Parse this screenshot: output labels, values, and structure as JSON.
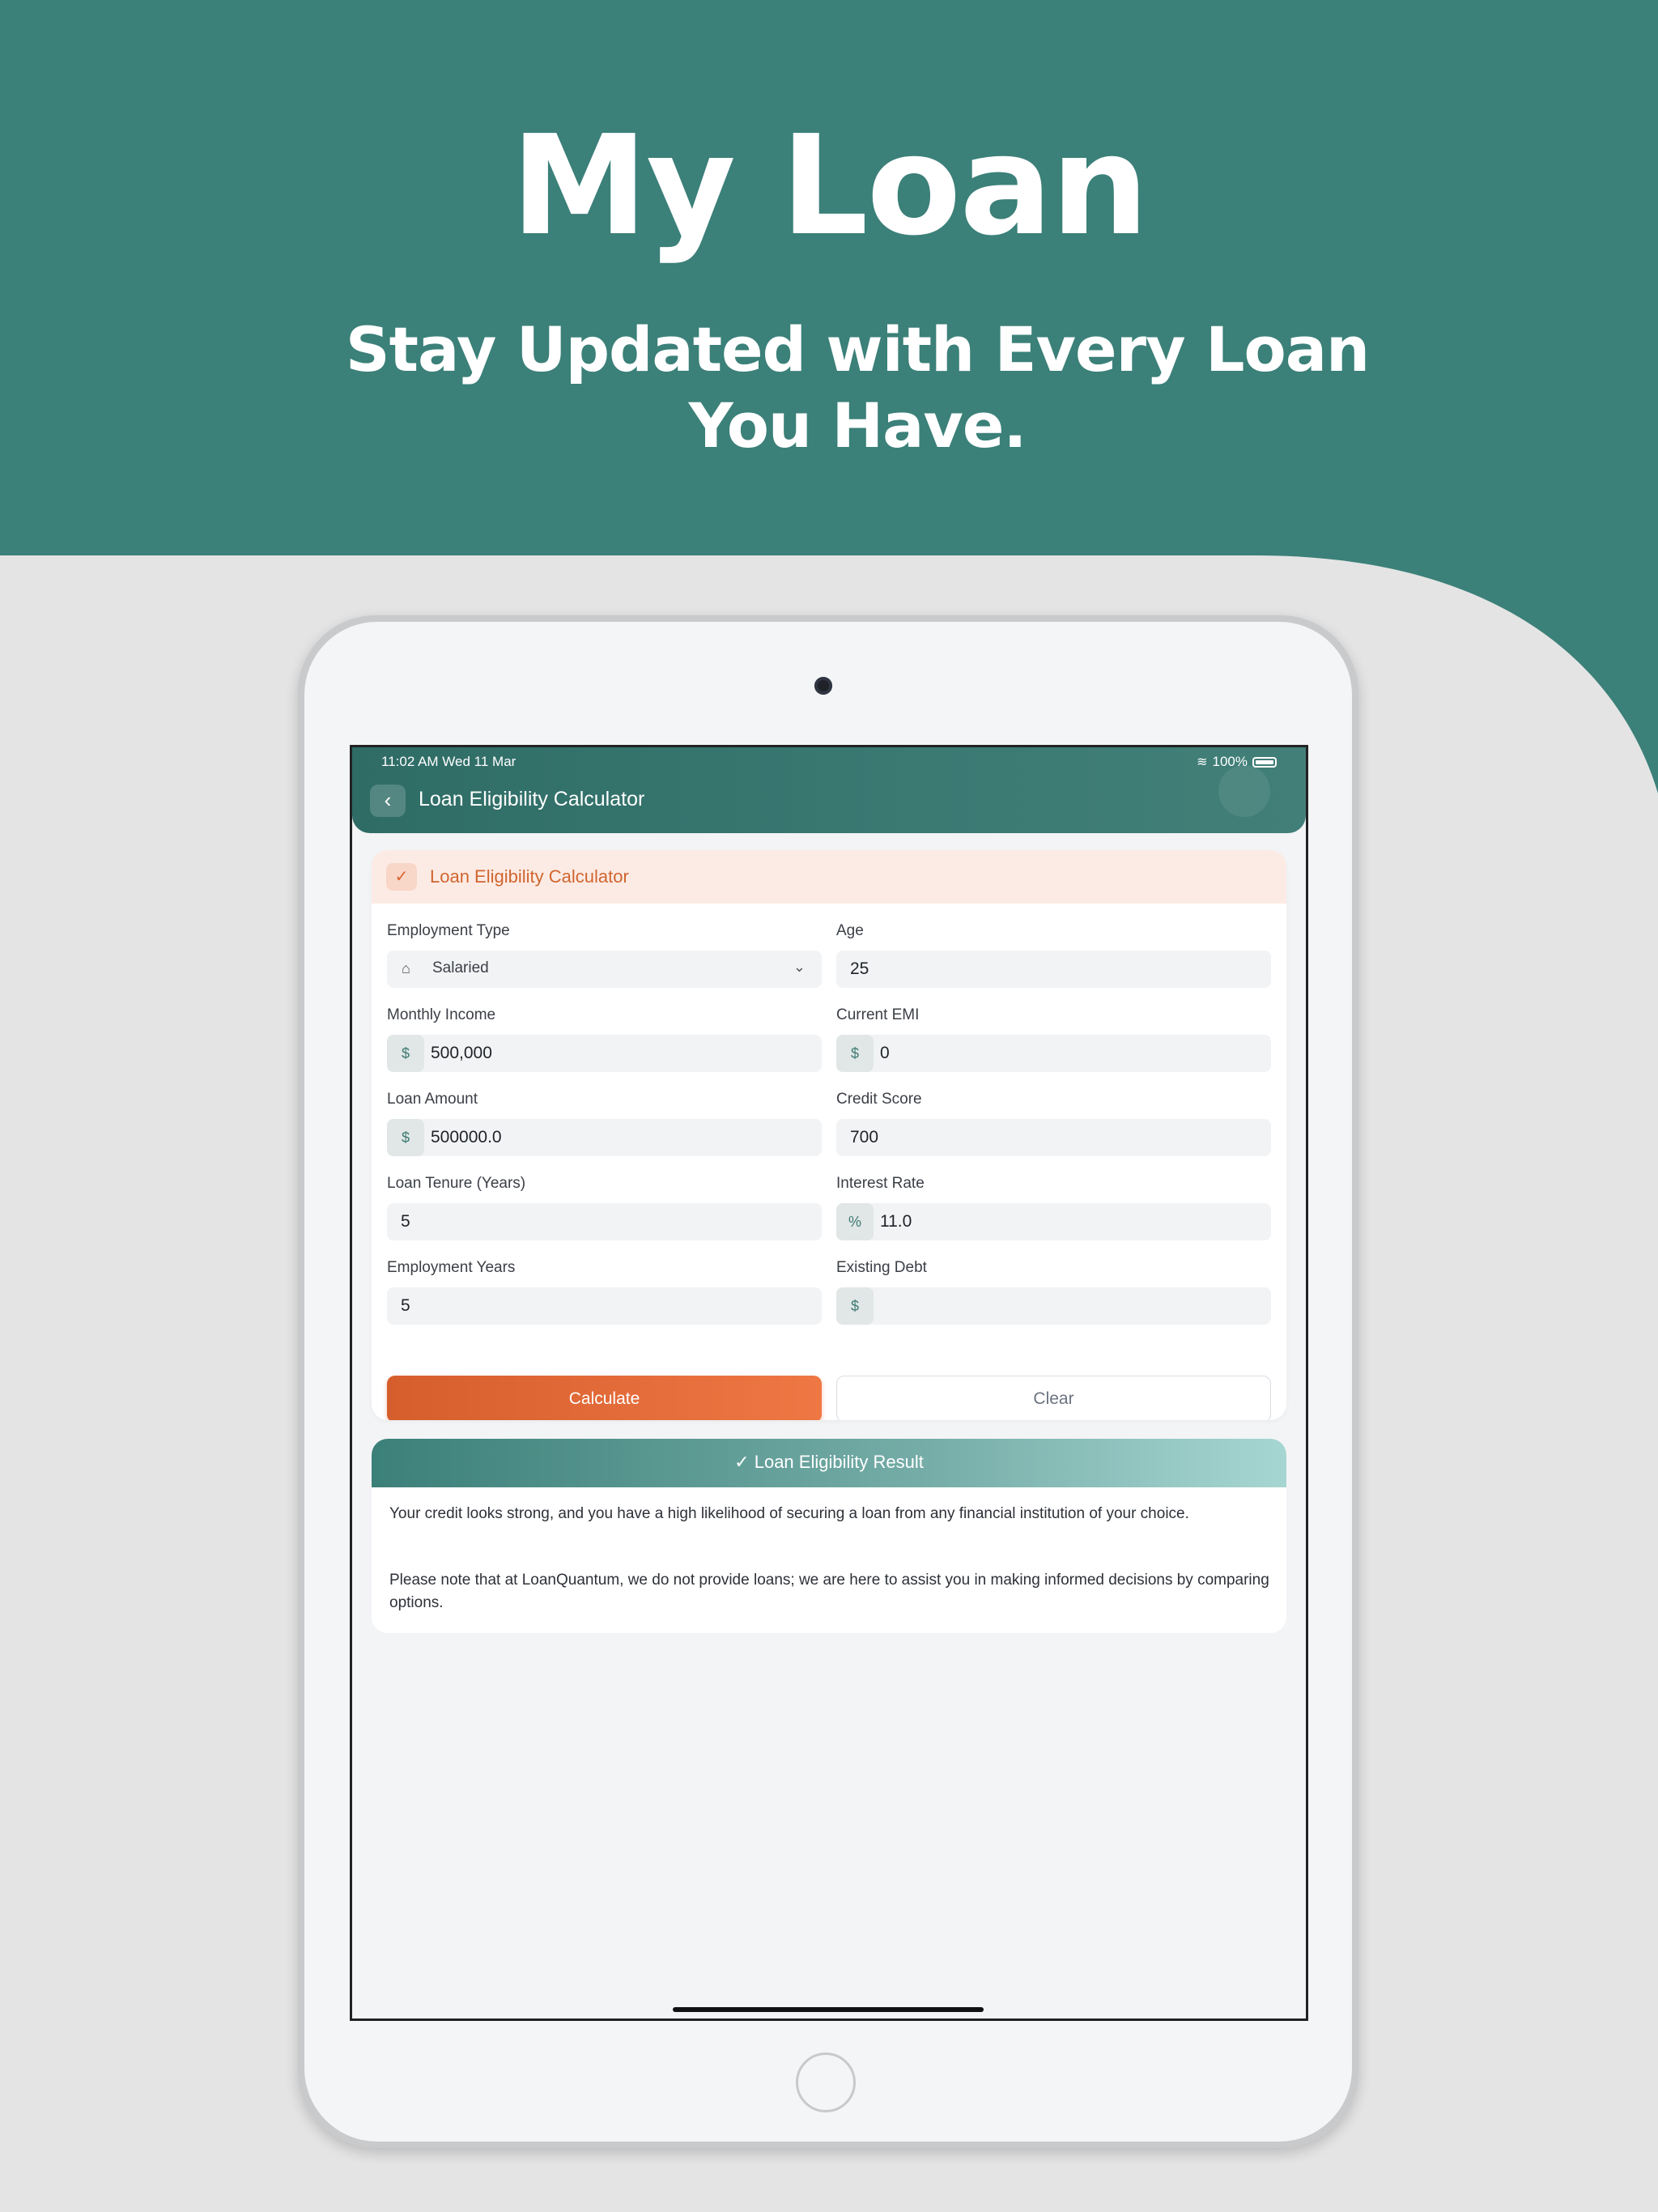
{
  "promo": {
    "headline": "My Loan",
    "subline": "Stay Updated with Every Loan You Have."
  },
  "status_bar": {
    "time_date": "11:02 AM   Wed 11 Mar",
    "battery": "100%"
  },
  "app_header": {
    "back_icon": "‹",
    "title": "Loan Eligibility Calculator"
  },
  "form_card": {
    "title": "Loan Eligibility Calculator",
    "icon": "✓",
    "fields": {
      "employment_type": {
        "label": "Employment Type",
        "value": "Salaried",
        "icon": "briefcase-icon"
      },
      "age": {
        "label": "Age",
        "value": "25"
      },
      "monthly_income": {
        "label": "Monthly Income",
        "prefix": "$",
        "value": "500,000"
      },
      "current_emi": {
        "label": "Current EMI",
        "prefix": "$",
        "value": "0"
      },
      "loan_amount": {
        "label": "Loan Amount",
        "prefix": "$",
        "value": "500000.0"
      },
      "credit_score": {
        "label": "Credit Score",
        "value": "700"
      },
      "loan_tenure": {
        "label": "Loan Tenure (Years)",
        "value": "5"
      },
      "interest_rate": {
        "label": "Interest Rate",
        "prefix": "%",
        "value": "11.0"
      },
      "employment_years": {
        "label": "Employment Years",
        "value": "5"
      },
      "existing_debt": {
        "label": "Existing Debt",
        "prefix": "$",
        "value": ""
      }
    },
    "calculate_label": "Calculate",
    "clear_label": "Clear"
  },
  "result_card": {
    "title": "✓  Loan Eligibility Result",
    "paragraph1": "Your credit looks strong, and you have a high likelihood of securing a loan from any financial institution of your choice.",
    "paragraph2": "Please note that at LoanQuantum, we do not provide loans; we are here to assist you in making informed decisions by comparing options."
  },
  "colors": {
    "brand_teal": "#3b8079",
    "accent_orange": "#d9622e",
    "page_grey": "#e4e4e4"
  }
}
